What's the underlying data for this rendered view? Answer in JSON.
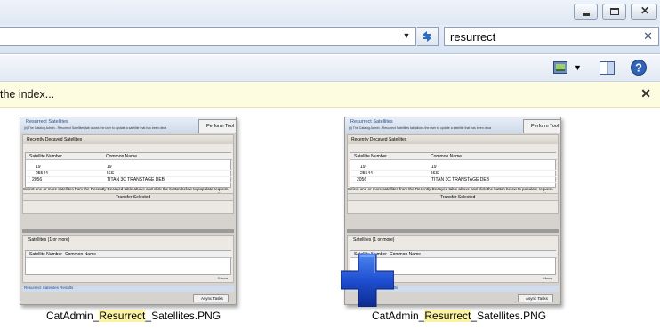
{
  "window": {
    "minimize_label": "minimize",
    "maximize_label": "maximize",
    "close_label": "close"
  },
  "address": {
    "value": ""
  },
  "search": {
    "value": "resurrect"
  },
  "infobar": {
    "text": "the index..."
  },
  "files": [
    {
      "name_prefix": "CatAdmin_",
      "name_match": "Resurrect",
      "name_suffix": "_Satellites.PNG",
      "thumb": {
        "title": "Resurrect Satellites",
        "subtitle": "(ii) The Catalog Admin - Resurrect Satellites tab allows the user to update a satellite that has been decayed.",
        "perform_button": "Perform Tool",
        "decayed_title": "Recently Decayed Satellites",
        "col_number": "Satellite Number",
        "col_name": "Common Name",
        "rows": [
          {
            "num": "19",
            "name": "19"
          },
          {
            "num": "25544",
            "name": "ISS"
          },
          {
            "num": "2056",
            "name": "TITAN 3C TRANSTAGE DEB"
          }
        ],
        "items_label": "3 items",
        "instruction": "Select one or more satellites from the Recently Decayed table above and click the button below to populate request.",
        "transfer_button": "Transfer Selected",
        "satellites_title": "Satellites (1 or more)",
        "items_label2": "0 items",
        "results_title": "Resurrect Satellites Results",
        "async_button": "Async Tasks"
      }
    },
    {
      "name_prefix": "CatAdmin_",
      "name_match": "Resurrect",
      "name_suffix": "_Satellites.PNG",
      "thumb": {
        "title": "Resurrect Satellites",
        "subtitle": "(ii) The Catalog Admin - Resurrect Satellites tab allows the user to update a satellite that has been decayed.",
        "perform_button": "Perform Tool",
        "decayed_title": "Recently Decayed Satellites",
        "col_number": "Satellite Number",
        "col_name": "Common Name",
        "rows": [
          {
            "num": "19",
            "name": "19"
          },
          {
            "num": "25544",
            "name": "ISS"
          },
          {
            "num": "2056",
            "name": "TITAN 3C TRANSTAGE DEB"
          }
        ],
        "items_label": "3 items",
        "instruction": "Select one or more satellites from the Recently Decayed table above and click the button below to populate request.",
        "transfer_button": "Transfer Selected",
        "satellites_title": "Satellites (1 or more)",
        "items_label2": "0 items",
        "results_title": "Resurrect Satellites Results",
        "async_button": "Async Tasks"
      }
    }
  ],
  "colors": {
    "infobar_bg": "#fdfbe0",
    "highlight": "#fbf3a1",
    "overlay_icon": "#1f4fd1"
  },
  "icons": {
    "overlay": "plus-cross-icon",
    "refresh": "refresh-icon",
    "search_clear": "close-icon",
    "help": "help-icon",
    "preview_pane": "preview-pane-icon",
    "change_view": "change-view-icon"
  }
}
